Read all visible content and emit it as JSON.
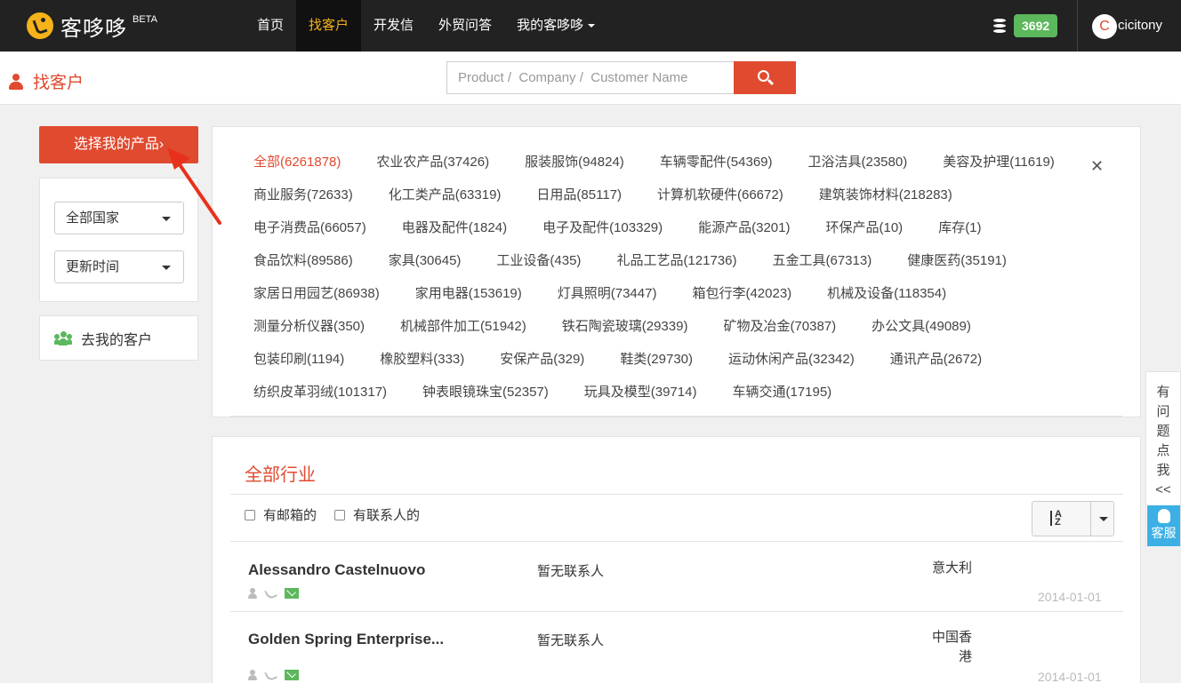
{
  "brand": {
    "name": "客哆哆",
    "tag": "BETA"
  },
  "nav": [
    {
      "label": "首页",
      "active": false
    },
    {
      "label": "找客户",
      "active": true
    },
    {
      "label": "开发信",
      "active": false
    },
    {
      "label": "外贸问答",
      "active": false
    },
    {
      "label": "我的客哆哆",
      "active": false,
      "dropdown": true
    }
  ],
  "user": {
    "credits": "3692",
    "avatar_letter": "C",
    "name": "cicitony"
  },
  "page": {
    "title": "找客户"
  },
  "search": {
    "placeholder": "Product /  Company /  Customer Name"
  },
  "left": {
    "select_product_label": "选择我的产品",
    "country_filter": "全部国家",
    "time_filter": "更新时间",
    "my_clients_label": "去我的客户"
  },
  "categories": [
    [
      "全部(6261878)",
      "农业农产品(37426)",
      "服装服饰(94824)",
      "车辆零配件(54369)",
      "卫浴洁具(23580)",
      "美容及护理(11619)"
    ],
    [
      "商业服务(72633)",
      "化工类产品(63319)",
      "日用品(85117)",
      "计算机软硬件(66672)",
      "建筑装饰材料(218283)"
    ],
    [
      "电子消费品(66057)",
      "电器及配件(1824)",
      "电子及配件(103329)",
      "能源产品(3201)",
      "环保产品(10)",
      "库存(1)"
    ],
    [
      "食品饮料(89586)",
      "家具(30645)",
      "工业设备(435)",
      "礼品工艺品(121736)",
      "五金工具(67313)",
      "健康医药(35191)"
    ],
    [
      "家居日用园艺(86938)",
      "家用电器(153619)",
      "灯具照明(73447)",
      "箱包行李(42023)",
      "机械及设备(118354)"
    ],
    [
      "测量分析仪器(350)",
      "机械部件加工(51942)",
      "铁石陶瓷玻璃(29339)",
      "矿物及冶金(70387)",
      "办公文具(49089)"
    ],
    [
      "包装印刷(1194)",
      "橡胶塑料(333)",
      "安保产品(329)",
      "鞋类(29730)",
      "运动休闲产品(32342)",
      "通讯产品(2672)"
    ],
    [
      "纺织皮革羽绒(101317)",
      "钟表眼镜珠宝(52357)",
      "玩具及模型(39714)",
      "车辆交通(17195)"
    ]
  ],
  "results": {
    "title": "全部行业",
    "filters": {
      "has_email": "有邮箱的",
      "has_contact": "有联系人的"
    },
    "sort_icon": "sort-alpha-icon",
    "rows": [
      {
        "name": "Alessandro Castelnuovo",
        "contact": "暂无联系人",
        "country": "意大利",
        "date": "2014-01-01"
      },
      {
        "name": "Golden Spring Enterprise...",
        "contact": "暂无联系人",
        "country": "中国香港",
        "date": "2014-01-01"
      }
    ]
  },
  "feedback": {
    "text": [
      "有",
      "问",
      "题",
      "点",
      "我",
      "<<"
    ],
    "service_label": "客服"
  },
  "colors": {
    "accent": "#e04a2f",
    "nav_bg": "#222222",
    "badge_green": "#5cb85c",
    "service_blue": "#3cb0e5",
    "brand_yellow": "#f5b31a"
  }
}
